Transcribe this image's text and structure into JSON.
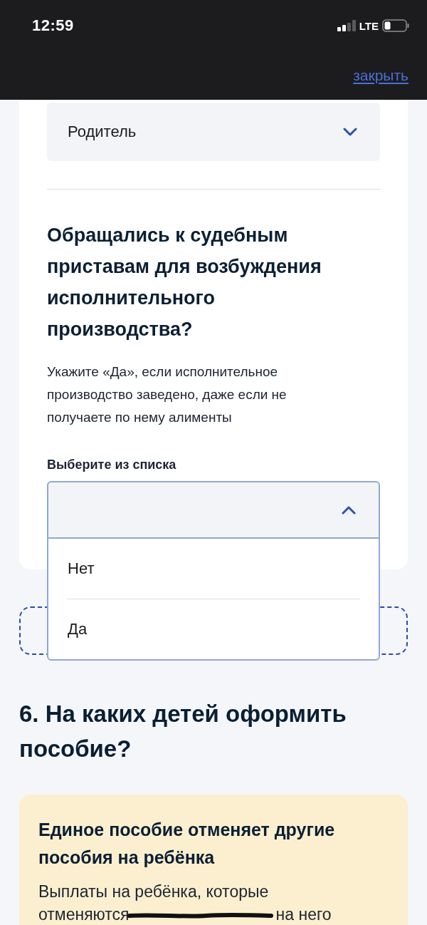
{
  "status_bar": {
    "time": "12:59",
    "network": "LTE"
  },
  "header": {
    "close_link": "закрыть"
  },
  "form_card": {
    "relation_select": {
      "value": "Родитель",
      "expanded": false
    },
    "question": {
      "title": "Обращались к судебным приставам для возбуждения исполнительного производства?",
      "hint": "Укажите «Да», если исполнительное производство заведено, даже если не получаете по нему алименты",
      "select": {
        "label": "Выберите из списка",
        "expanded": true,
        "options": [
          {
            "label": "Нет",
            "selected": false
          },
          {
            "label": "Да",
            "selected": false
          }
        ]
      }
    }
  },
  "section": {
    "title": "6. На каких детей оформить пособие?"
  },
  "notice": {
    "title": "Единое пособие отменяет другие пособия на ребёнка",
    "body_line": "Выплаты на ребёнка, которые",
    "before_scribble": "отменяются",
    "after_scribble": "на него"
  }
}
